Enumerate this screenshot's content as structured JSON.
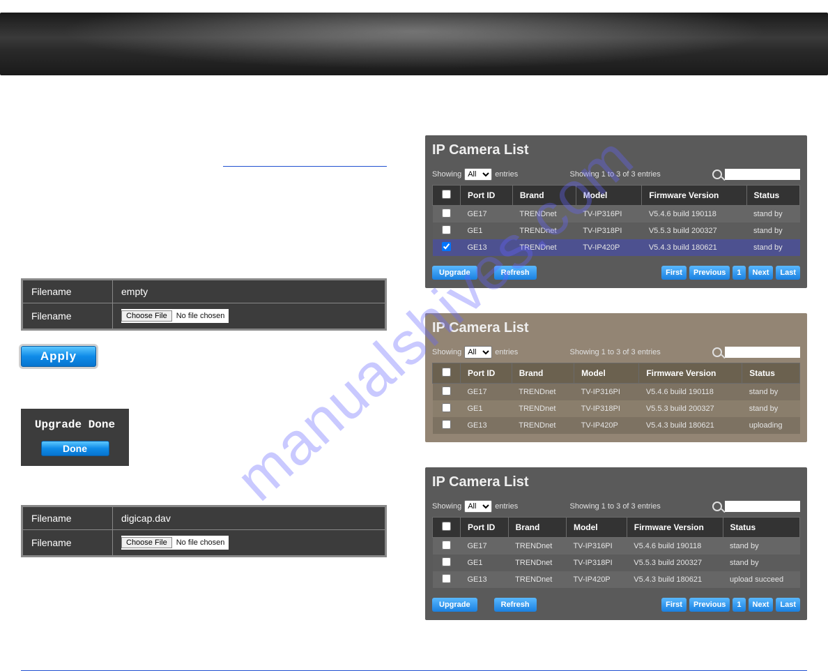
{
  "watermark": "manualshives.com",
  "file_block_1": {
    "rows": [
      {
        "label": "Filename",
        "value": "empty"
      },
      {
        "label": "Filename",
        "choose_label": "Choose File",
        "no_file_label": "No file chosen"
      }
    ]
  },
  "buttons": {
    "apply": "Apply",
    "done": "Done"
  },
  "upgrade_done": "Upgrade Done",
  "file_block_2": {
    "rows": [
      {
        "label": "Filename",
        "value": "digicap.dav"
      },
      {
        "label": "Filename",
        "choose_label": "Choose File",
        "no_file_label": "No file chosen"
      }
    ]
  },
  "panels": [
    {
      "title": "IP Camera List",
      "showing_label": "Showing",
      "entries_label": "entries",
      "entries_value": "All",
      "showing_summary": "Showing 1 to 3 of 3 entries",
      "columns": [
        "",
        "Port ID",
        "Brand",
        "Model",
        "Firmware Version",
        "Status"
      ],
      "rows": [
        {
          "checked": false,
          "portid": "GE17",
          "brand": "TRENDnet",
          "model": "TV-IP316PI",
          "fw": "V5.4.6 build 190118",
          "status": "stand by"
        },
        {
          "checked": false,
          "portid": "GE1",
          "brand": "TRENDnet",
          "model": "TV-IP318PI",
          "fw": "V5.5.3 build 200327",
          "status": "stand by"
        },
        {
          "checked": true,
          "selected": true,
          "portid": "GE13",
          "brand": "TRENDnet",
          "model": "TV-IP420P",
          "fw": "V5.4.3 build 180621",
          "status": "stand by"
        }
      ],
      "actions": {
        "upgrade": "Upgrade",
        "refresh": "Refresh"
      },
      "pager": {
        "first": "First",
        "previous": "Previous",
        "page": "1",
        "next": "Next",
        "last": "Last"
      }
    },
    {
      "title": "IP Camera List",
      "showing_label": "Showing",
      "entries_label": "entries",
      "entries_value": "All",
      "showing_summary": "Showing 1 to 3 of 3 entries",
      "columns": [
        "",
        "Port ID",
        "Brand",
        "Model",
        "Firmware Version",
        "Status"
      ],
      "rows": [
        {
          "checked": false,
          "portid": "GE17",
          "brand": "TRENDnet",
          "model": "TV-IP316PI",
          "fw": "V5.4.6 build 190118",
          "status": "stand by"
        },
        {
          "checked": false,
          "portid": "GE1",
          "brand": "TRENDnet",
          "model": "TV-IP318PI",
          "fw": "V5.5.3 build 200327",
          "status": "stand by"
        },
        {
          "checked": false,
          "portid": "GE13",
          "brand": "TRENDnet",
          "model": "TV-IP420P",
          "fw": "V5.4.3 build 180621",
          "status": "uploading"
        }
      ]
    },
    {
      "title": "IP Camera List",
      "showing_label": "Showing",
      "entries_label": "entries",
      "entries_value": "All",
      "showing_summary": "Showing 1 to 3 of 3 entries",
      "columns": [
        "",
        "Port ID",
        "Brand",
        "Model",
        "Firmware Version",
        "Status"
      ],
      "rows": [
        {
          "checked": false,
          "portid": "GE17",
          "brand": "TRENDnet",
          "model": "TV-IP316PI",
          "fw": "V5.4.6 build 190118",
          "status": "stand by"
        },
        {
          "checked": false,
          "portid": "GE1",
          "brand": "TRENDnet",
          "model": "TV-IP318PI",
          "fw": "V5.5.3 build 200327",
          "status": "stand by"
        },
        {
          "checked": false,
          "portid": "GE13",
          "brand": "TRENDnet",
          "model": "TV-IP420P",
          "fw": "V5.4.3 build 180621",
          "status": "upload succeed"
        }
      ],
      "actions": {
        "upgrade": "Upgrade",
        "refresh": "Refresh"
      },
      "pager": {
        "first": "First",
        "previous": "Previous",
        "page": "1",
        "next": "Next",
        "last": "Last"
      }
    }
  ]
}
